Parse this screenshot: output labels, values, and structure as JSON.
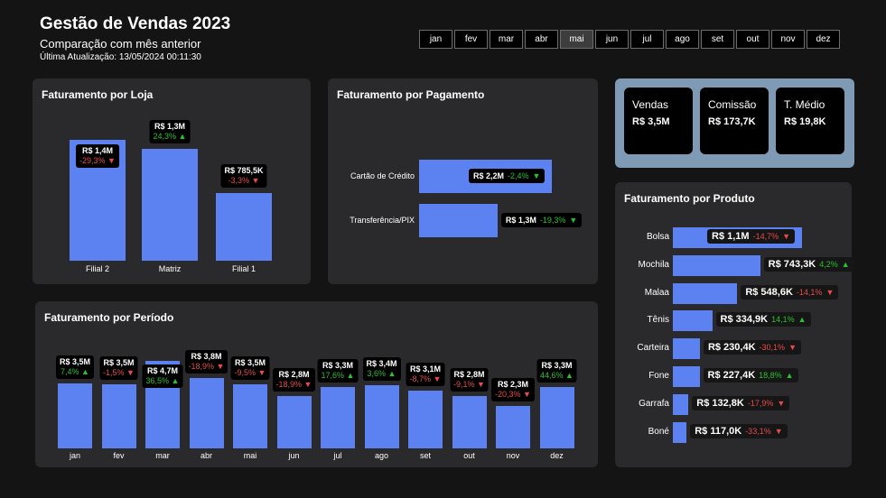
{
  "header": {
    "title": "Gestão de Vendas 2023",
    "subtitle": "Comparação com mês anterior",
    "updated": "Última Atualização: 13/05/2024 00:11:30"
  },
  "months": [
    "jan",
    "fev",
    "mar",
    "abr",
    "mai",
    "jun",
    "jul",
    "ago",
    "set",
    "out",
    "nov",
    "dez"
  ],
  "selected_month": "mai",
  "colors": {
    "bar": "#5b82f0",
    "negative": "#e84b4b",
    "positive": "#27c22e",
    "kpi_bg": "#7f9ab5"
  },
  "icons": {
    "up": "triangle-up-icon",
    "down": "triangle-down-icon"
  },
  "loja": {
    "title": "Faturamento por Loja",
    "items": [
      {
        "name": "Filial 2",
        "label": "R$ 1,4M",
        "pct": "-29,3%",
        "dir": "down",
        "value": 1.4
      },
      {
        "name": "Matriz",
        "label": "R$ 1,3M",
        "pct": "24,3%",
        "dir": "up",
        "value": 1.3
      },
      {
        "name": "Filial 1",
        "label": "R$ 785,5K",
        "pct": "-3,3%",
        "dir": "down",
        "value": 0.7855
      }
    ]
  },
  "pagamento": {
    "title": "Faturamento por Pagamento",
    "items": [
      {
        "name": "Cartão de Crédito",
        "label": "R$ 2,2M",
        "pct": "-2,4%",
        "dir": "down",
        "value": 2.2
      },
      {
        "name": "Transferência/PIX",
        "label": "R$ 1,3M",
        "pct": "-19,3%",
        "dir": "down",
        "value": 1.3
      }
    ]
  },
  "kpis": [
    {
      "label": "Vendas",
      "value": "R$ 3,5M"
    },
    {
      "label": "Comissão",
      "value": "R$ 173,7K"
    },
    {
      "label": "T. Médio",
      "value": "R$ 19,8K"
    }
  ],
  "periodo": {
    "title": "Faturamento por Período",
    "items": [
      {
        "name": "jan",
        "label": "R$ 3,5M",
        "pct": "7,4%",
        "dir": "up",
        "value": 3.5
      },
      {
        "name": "fev",
        "label": "R$ 3,5M",
        "pct": "-1,5%",
        "dir": "down",
        "value": 3.45
      },
      {
        "name": "mar",
        "label": "R$ 4,7M",
        "pct": "36,5%",
        "dir": "up",
        "value": 4.7
      },
      {
        "name": "abr",
        "label": "R$ 3,8M",
        "pct": "-18,9%",
        "dir": "down",
        "value": 3.8
      },
      {
        "name": "mai",
        "label": "R$ 3,5M",
        "pct": "-9,5%",
        "dir": "down",
        "value": 3.45
      },
      {
        "name": "jun",
        "label": "R$ 2,8M",
        "pct": "-18,9%",
        "dir": "down",
        "value": 2.8
      },
      {
        "name": "jul",
        "label": "R$ 3,3M",
        "pct": "17,6%",
        "dir": "up",
        "value": 3.3
      },
      {
        "name": "ago",
        "label": "R$ 3,4M",
        "pct": "3,6%",
        "dir": "up",
        "value": 3.4
      },
      {
        "name": "set",
        "label": "R$ 3,1M",
        "pct": "-8,7%",
        "dir": "down",
        "value": 3.1
      },
      {
        "name": "out",
        "label": "R$ 2,8M",
        "pct": "-9,1%",
        "dir": "down",
        "value": 2.8
      },
      {
        "name": "nov",
        "label": "R$ 2,3M",
        "pct": "-20,3%",
        "dir": "down",
        "value": 2.3
      },
      {
        "name": "dez",
        "label": "R$ 3,3M",
        "pct": "44,6%",
        "dir": "up",
        "value": 3.3
      }
    ]
  },
  "produto": {
    "title": "Faturamento por Produto",
    "items": [
      {
        "name": "Bolsa",
        "label": "R$ 1,1M",
        "pct": "-14,7%",
        "dir": "down",
        "value": 1.1
      },
      {
        "name": "Mochila",
        "label": "R$ 743,3K",
        "pct": "4,2%",
        "dir": "up",
        "value": 0.7433
      },
      {
        "name": "Malaa",
        "label": "R$ 548,6K",
        "pct": "-14,1%",
        "dir": "down",
        "value": 0.5486
      },
      {
        "name": "Tênis",
        "label": "R$ 334,9K",
        "pct": "14,1%",
        "dir": "up",
        "value": 0.3349
      },
      {
        "name": "Carteira",
        "label": "R$ 230,4K",
        "pct": "-30,1%",
        "dir": "down",
        "value": 0.2304
      },
      {
        "name": "Fone",
        "label": "R$ 227,4K",
        "pct": "18,8%",
        "dir": "up",
        "value": 0.2274
      },
      {
        "name": "Garrafa",
        "label": "R$ 132,8K",
        "pct": "-17,9%",
        "dir": "down",
        "value": 0.1328
      },
      {
        "name": "Boné",
        "label": "R$ 117,0K",
        "pct": "-33,1%",
        "dir": "down",
        "value": 0.117
      }
    ]
  }
}
